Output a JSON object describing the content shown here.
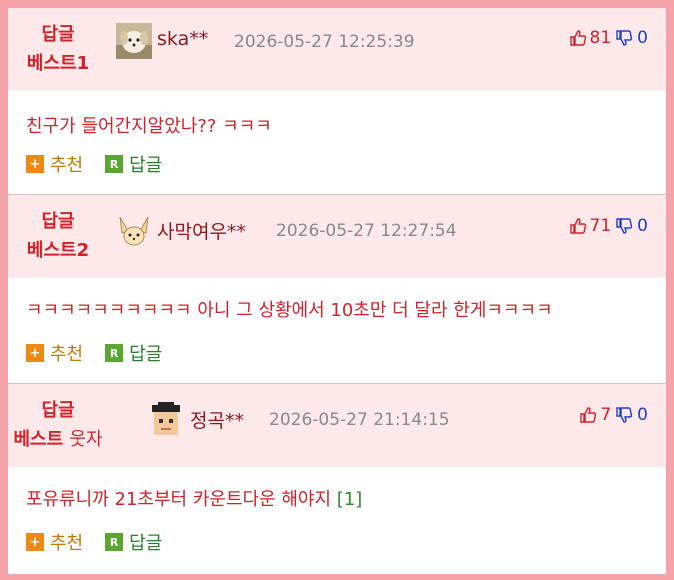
{
  "comments": [
    {
      "badge_line1": "답글",
      "badge_line2": "베스트1",
      "badge_extra": "",
      "avatar_icon": "puppy-avatar",
      "user": "ska**",
      "date": "2026-05-27 12:25:39",
      "up": "81",
      "down": "0",
      "text": "친구가 들어간지알았나?? ㅋㅋㅋ",
      "ref": "",
      "recommend_label": "추천",
      "reply_label": "답글"
    },
    {
      "badge_line1": "답글",
      "badge_line2": "베스트2",
      "badge_extra": "",
      "avatar_icon": "fennec-fox-avatar",
      "user": "사막여우**",
      "date": "2026-05-27 12:27:54",
      "up": "71",
      "down": "0",
      "text": "ㅋㅋㅋㅋㅋㅋㅋㅋㅋㅋ 아니 그 상황에서 10초만 더 달라 한게ㅋㅋㅋㅋ",
      "ref": "",
      "recommend_label": "추천",
      "reply_label": "답글"
    },
    {
      "badge_line1": "답글",
      "badge_line2": "베스트",
      "badge_extra": "웃자",
      "avatar_icon": "graduate-avatar",
      "user": "정곡**",
      "date": "2026-05-27 21:14:15",
      "up": "7",
      "down": "0",
      "text": "포유류니까 21초부터 카운트다운 해야지",
      "ref": "[1]",
      "recommend_label": "추천",
      "reply_label": "답글"
    }
  ],
  "colors": {
    "border": "#f4a4a8",
    "header_bg": "#fde8ea",
    "accent_red": "#d3212a",
    "down_blue": "#1a3fd0"
  }
}
